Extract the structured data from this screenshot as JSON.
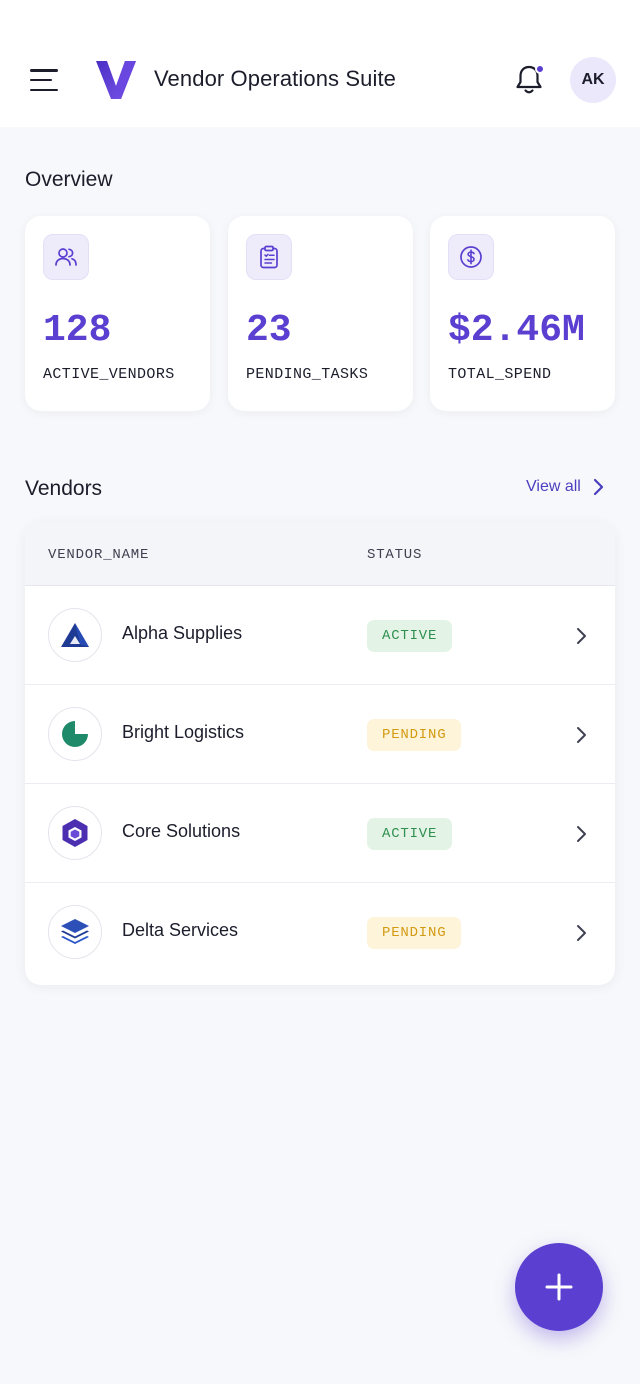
{
  "header": {
    "app_title": "Vendor Operations Suite",
    "avatar_initials": "AK",
    "notifications_unread": true
  },
  "overview": {
    "title": "Overview",
    "stats": [
      {
        "value": "128",
        "label": "ACTIVE_VENDORS",
        "icon": "users-icon"
      },
      {
        "value": "23",
        "label": "PENDING_TASKS",
        "icon": "clipboard-icon"
      },
      {
        "value": "$2.46M",
        "label": "TOTAL_SPEND",
        "icon": "dollar-circle-icon"
      }
    ]
  },
  "vendors": {
    "title": "Vendors",
    "view_all_label": "View all",
    "columns": [
      "VENDOR_NAME",
      "STATUS"
    ],
    "rows": [
      {
        "name": "Alpha Supplies",
        "status": "ACTIVE",
        "logo": "triangle-logo-icon"
      },
      {
        "name": "Bright Logistics",
        "status": "PENDING",
        "logo": "pie-logo-icon"
      },
      {
        "name": "Core Solutions",
        "status": "ACTIVE",
        "logo": "hexagon-logo-icon"
      },
      {
        "name": "Delta Services",
        "status": "PENDING",
        "logo": "layers-logo-icon"
      }
    ]
  },
  "colors": {
    "accent": "#5b3fd0",
    "active_bg": "#e3f4e7",
    "active_text": "#2f8f4e",
    "pending_bg": "#fdf4d9",
    "pending_text": "#d39a12"
  }
}
